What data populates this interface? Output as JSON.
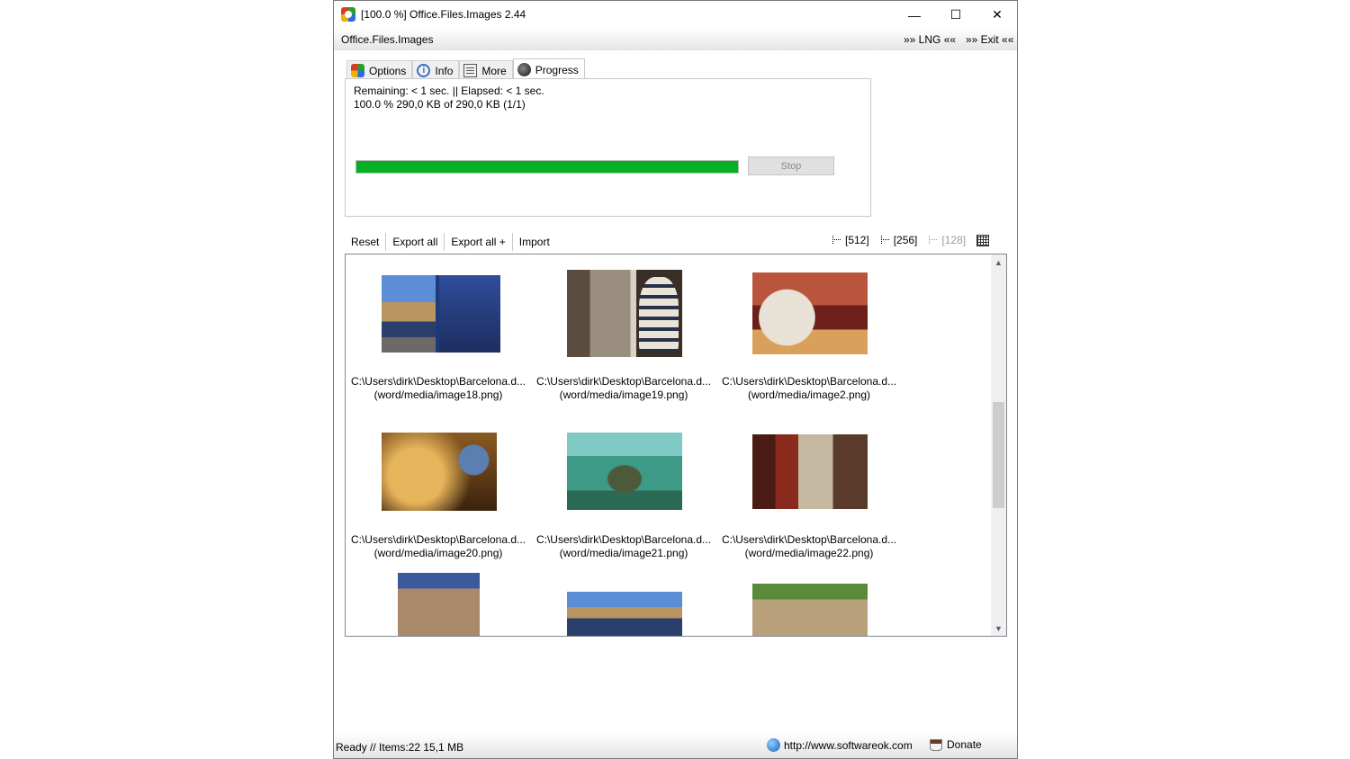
{
  "window": {
    "title": "[100.0 %] Office.Files.Images 2.44",
    "minimize": "—",
    "maximize": "☐",
    "close": "✕"
  },
  "menu": {
    "app": "Office.Files.Images",
    "lng": "»» LNG ««",
    "exit": "»» Exit ««"
  },
  "tabs": [
    {
      "label": "Options",
      "icon": "options-icon"
    },
    {
      "label": "Info",
      "icon": "info-icon"
    },
    {
      "label": "More",
      "icon": "more-icon"
    },
    {
      "label": "Progress",
      "icon": "progress-icon",
      "active": true
    }
  ],
  "progress": {
    "remaining": "Remaining: < 1 sec. || Elapsed: < 1 sec.",
    "size": "100.0 % 290,0 KB of 290,0 KB (1/1)",
    "percent": 100,
    "stop_label": "Stop"
  },
  "toolbar": {
    "reset": "Reset",
    "export_all": "Export all",
    "export_all_plus": "Export all +",
    "import": "Import",
    "size_512": "[512]",
    "size_256": "[256]",
    "size_128": "[128]"
  },
  "items": [
    {
      "path": "C:\\Users\\dirk\\Desktop\\Barcelona.d...",
      "media": "(word/media/image18.png)"
    },
    {
      "path": "C:\\Users\\dirk\\Desktop\\Barcelona.d...",
      "media": "(word/media/image19.png)"
    },
    {
      "path": "C:\\Users\\dirk\\Desktop\\Barcelona.d...",
      "media": "(word/media/image2.png)"
    },
    {
      "path": "C:\\Users\\dirk\\Desktop\\Barcelona.d...",
      "media": "(word/media/image20.png)"
    },
    {
      "path": "C:\\Users\\dirk\\Desktop\\Barcelona.d...",
      "media": "(word/media/image21.png)"
    },
    {
      "path": "C:\\Users\\dirk\\Desktop\\Barcelona.d...",
      "media": "(word/media/image22.png)"
    }
  ],
  "status": {
    "text": "Ready // Items:22 15,1 MB",
    "url": "http://www.softwareok.com",
    "donate": "Donate"
  },
  "colors": {
    "progress_fill": "#06b025"
  }
}
